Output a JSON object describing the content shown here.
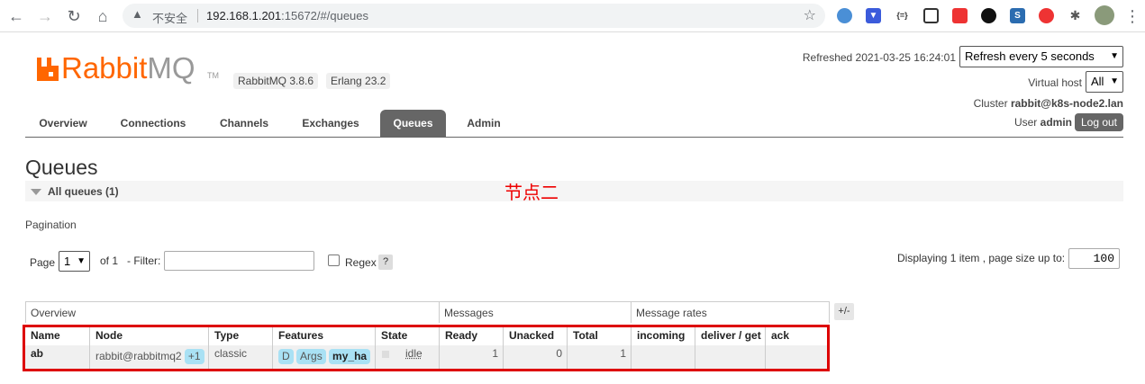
{
  "browser": {
    "insecure_label": "不安全",
    "url_host": "192.168.1.201",
    "url_rest": ":15672/#/queues"
  },
  "app": {
    "brand_rabbit": "Rabbit",
    "brand_mq": "MQ",
    "brand_tm": "TM",
    "rabbitmq_version": "RabbitMQ 3.8.6",
    "erlang_version": "Erlang 23.2"
  },
  "header": {
    "refreshed_text": "Refreshed 2021-03-25 16:24:01",
    "refresh_select": "Refresh every 5 seconds",
    "vhost_label": "Virtual host",
    "vhost_select": "All",
    "cluster_label": "Cluster",
    "cluster_name": "rabbit@k8s-node2.lan",
    "user_label": "User",
    "user_name": "admin",
    "logout_label": "Log out"
  },
  "tabs": [
    {
      "label": "Overview"
    },
    {
      "label": "Connections"
    },
    {
      "label": "Channels"
    },
    {
      "label": "Exchanges"
    },
    {
      "label": "Queues"
    },
    {
      "label": "Admin"
    }
  ],
  "page": {
    "title": "Queues",
    "section_title": "All queues (1)",
    "annotation": "节点二"
  },
  "pagination": {
    "label": "Pagination",
    "page_label": "Page",
    "page_value": "1",
    "of_label": "of 1",
    "filter_label": "- Filter:",
    "filter_value": "",
    "regex_label": "Regex",
    "help_label": "?",
    "display_label": "Displaying 1 item , page size up to:",
    "page_size": "100"
  },
  "table": {
    "groups": [
      "Overview",
      "Messages",
      "Message rates"
    ],
    "toggle_label": "+/-",
    "columns": [
      "Name",
      "Node",
      "Type",
      "Features",
      "State",
      "Ready",
      "Unacked",
      "Total",
      "incoming",
      "deliver / get",
      "ack"
    ],
    "rows": [
      {
        "name": "ab",
        "node": "rabbit@rabbitmq2",
        "node_extra": "+1",
        "type": "classic",
        "features": [
          "D",
          "Args",
          "my_ha"
        ],
        "state": "idle",
        "ready": "1",
        "unacked": "0",
        "total": "1",
        "incoming": "",
        "deliver_get": "",
        "ack": ""
      }
    ]
  }
}
